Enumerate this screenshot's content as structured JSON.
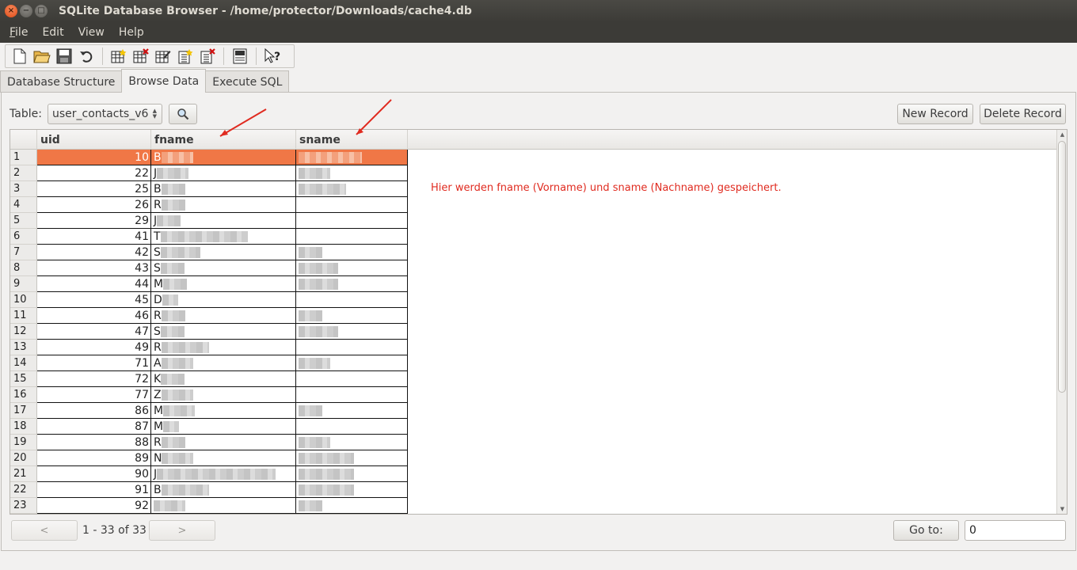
{
  "window": {
    "title": "SQLite Database Browser - /home/protector/Downloads/cache4.db"
  },
  "menu": [
    {
      "label": "File",
      "key": "F",
      "rest": "ile"
    },
    {
      "label": "Edit",
      "key": "",
      "rest": "Edit"
    },
    {
      "label": "View",
      "key": "",
      "rest": "View"
    },
    {
      "label": "Help",
      "key": "",
      "rest": "Help"
    }
  ],
  "tabs": [
    "Database Structure",
    "Browse Data",
    "Execute SQL"
  ],
  "browse": {
    "table_label": "Table:",
    "table_value": "user_contacts_v6",
    "new_record": "New Record",
    "delete_record": "Delete Record"
  },
  "grid": {
    "columns": [
      "uid",
      "fname",
      "sname"
    ],
    "rows": [
      {
        "n": "1",
        "uid": "10",
        "fn": "B",
        "sn": ""
      },
      {
        "n": "2",
        "uid": "22",
        "fn": "J",
        "sn": ""
      },
      {
        "n": "3",
        "uid": "25",
        "fn": "B",
        "sn": ""
      },
      {
        "n": "4",
        "uid": "26",
        "fn": "R",
        "sn": ""
      },
      {
        "n": "5",
        "uid": "29",
        "fn": "J",
        "sn": ""
      },
      {
        "n": "6",
        "uid": "41",
        "fn": "T",
        "sn": ""
      },
      {
        "n": "7",
        "uid": "42",
        "fn": "S",
        "sn": ""
      },
      {
        "n": "8",
        "uid": "43",
        "fn": "S",
        "sn": ""
      },
      {
        "n": "9",
        "uid": "44",
        "fn": "M",
        "sn": ""
      },
      {
        "n": "10",
        "uid": "45",
        "fn": "D",
        "sn": ""
      },
      {
        "n": "11",
        "uid": "46",
        "fn": "R",
        "sn": ""
      },
      {
        "n": "12",
        "uid": "47",
        "fn": "S",
        "sn": ""
      },
      {
        "n": "13",
        "uid": "49",
        "fn": "R",
        "sn": ""
      },
      {
        "n": "14",
        "uid": "71",
        "fn": "A",
        "sn": ""
      },
      {
        "n": "15",
        "uid": "72",
        "fn": "K",
        "sn": ""
      },
      {
        "n": "16",
        "uid": "77",
        "fn": "Z",
        "sn": ""
      },
      {
        "n": "17",
        "uid": "86",
        "fn": "M",
        "sn": ""
      },
      {
        "n": "18",
        "uid": "87",
        "fn": "M",
        "sn": ""
      },
      {
        "n": "19",
        "uid": "88",
        "fn": "R",
        "sn": ""
      },
      {
        "n": "20",
        "uid": "89",
        "fn": "N",
        "sn": ""
      },
      {
        "n": "21",
        "uid": "90",
        "fn": "J",
        "sn": ""
      },
      {
        "n": "22",
        "uid": "91",
        "fn": "B",
        "sn": ""
      },
      {
        "n": "23",
        "uid": "92",
        "fn": "",
        "sn": ""
      }
    ]
  },
  "annotation": "Hier werden fname (Vorname) und sname (Nachname) gespeichert.",
  "nav": {
    "prev": "<",
    "next": ">",
    "page_info": "1 - 33 of 33",
    "goto_label": "Go to:",
    "goto_value": "0"
  },
  "icons": [
    "new-database-icon",
    "open-database-icon",
    "save-database-icon",
    "revert-changes-icon",
    "create-table-icon",
    "delete-table-icon",
    "modify-table-icon",
    "create-index-icon",
    "delete-index-icon",
    "sql-log-icon",
    "whats-this-icon"
  ],
  "colors": {
    "selection": "#f07746",
    "annotation": "#e02b20",
    "titlebar": "#3c3b37"
  }
}
